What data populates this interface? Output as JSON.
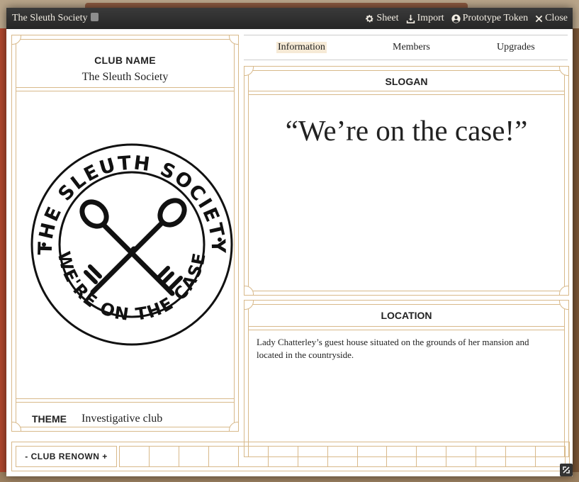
{
  "window": {
    "title": "The Sleuth Society",
    "actions": [
      {
        "label": "Sheet",
        "icon": "gear-icon"
      },
      {
        "label": "Import",
        "icon": "download-icon"
      },
      {
        "label": "Prototype Token",
        "icon": "user-circle-icon"
      },
      {
        "label": "Close",
        "icon": "close-icon"
      }
    ]
  },
  "club": {
    "name_label": "CLUB NAME",
    "name": "The Sleuth Society",
    "theme_label": "THEME",
    "theme": "Investigative club",
    "logo": {
      "ring_text_top": "THE SLEUTH SOCIETY",
      "ring_text_bottom": "WE'RE ON THE CASE",
      "icon": "crossed-keys-icon"
    }
  },
  "tabs": [
    {
      "label": "Information",
      "active": true
    },
    {
      "label": "Members",
      "active": false
    },
    {
      "label": "Upgrades",
      "active": false
    }
  ],
  "slogan": {
    "label": "SLOGAN",
    "text": "“We’re on the case!”"
  },
  "location": {
    "label": "LOCATION",
    "text": "Lady Chatterley’s guest house situated on the grounds of her mansion and located in the countryside."
  },
  "renown": {
    "label": "- CLUB RENOWN +",
    "filled": 0,
    "max": 15
  },
  "colors": {
    "frame": "#d8b98a",
    "titlebar": "#2e2e2e",
    "active_tab": "#f6ead6"
  }
}
